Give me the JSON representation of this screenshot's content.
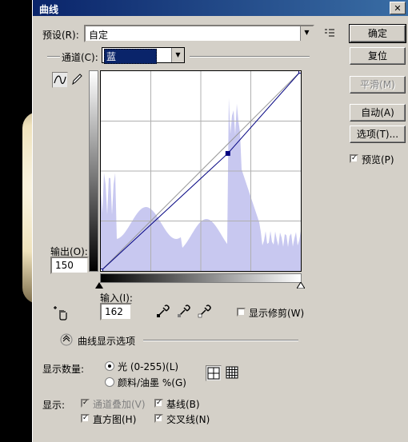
{
  "window": {
    "title": "曲线",
    "close_glyph": "✕"
  },
  "preset": {
    "label": "预设(R):",
    "value": "自定"
  },
  "channel": {
    "label": "通道(C):",
    "value": "蓝"
  },
  "buttons": {
    "ok": "确定",
    "reset": "复位",
    "smooth": "平滑(M)",
    "auto": "自动(A)",
    "options": "选项(T)..."
  },
  "preview": {
    "label": "预览(P)",
    "checked": true
  },
  "output": {
    "label": "输出(O):",
    "value": "150"
  },
  "input": {
    "label": "输入(I):",
    "value": "162"
  },
  "show_clipping": {
    "label": "显示修剪(W)",
    "checked": false
  },
  "curve_display_options": {
    "label": "曲线显示选项"
  },
  "show_amount": {
    "label": "显示数量:",
    "options": [
      {
        "label": "光 (0-255)(L)",
        "selected": true
      },
      {
        "label": "颜料/油墨 %(G)",
        "selected": false
      }
    ]
  },
  "show": {
    "label": "显示:",
    "channel_overlays": {
      "label": "通道叠加(V)",
      "checked": true,
      "disabled": true
    },
    "baseline": {
      "label": "基线(B)",
      "checked": true
    },
    "histogram": {
      "label": "直方图(H)",
      "checked": true
    },
    "intersection": {
      "label": "交叉线(N)",
      "checked": true
    }
  },
  "colors": {
    "histogram": "#c8c8f0",
    "curve": "#000080",
    "title_start": "#0a246a",
    "title_end": "#3a6ea5"
  },
  "icons": {
    "curve_tool": "curve-point-icon",
    "pencil_tool": "pencil-icon",
    "preset_menu": "preset-menu-icon",
    "hand_tool": "on-image-adjust-icon",
    "eyedropper_black": "black-point-eyedropper-icon",
    "eyedropper_gray": "gray-point-eyedropper-icon",
    "eyedropper_white": "white-point-eyedropper-icon",
    "grid_simple": "grid-4x4-icon",
    "grid_detailed": "grid-10x10-icon",
    "expand": "chevron-up-icon"
  },
  "chart_data": {
    "type": "area",
    "points": [
      [
        0,
        0
      ],
      [
        162,
        150
      ],
      [
        255,
        255
      ]
    ],
    "xlim": [
      0,
      255
    ],
    "ylim": [
      0,
      255
    ]
  }
}
